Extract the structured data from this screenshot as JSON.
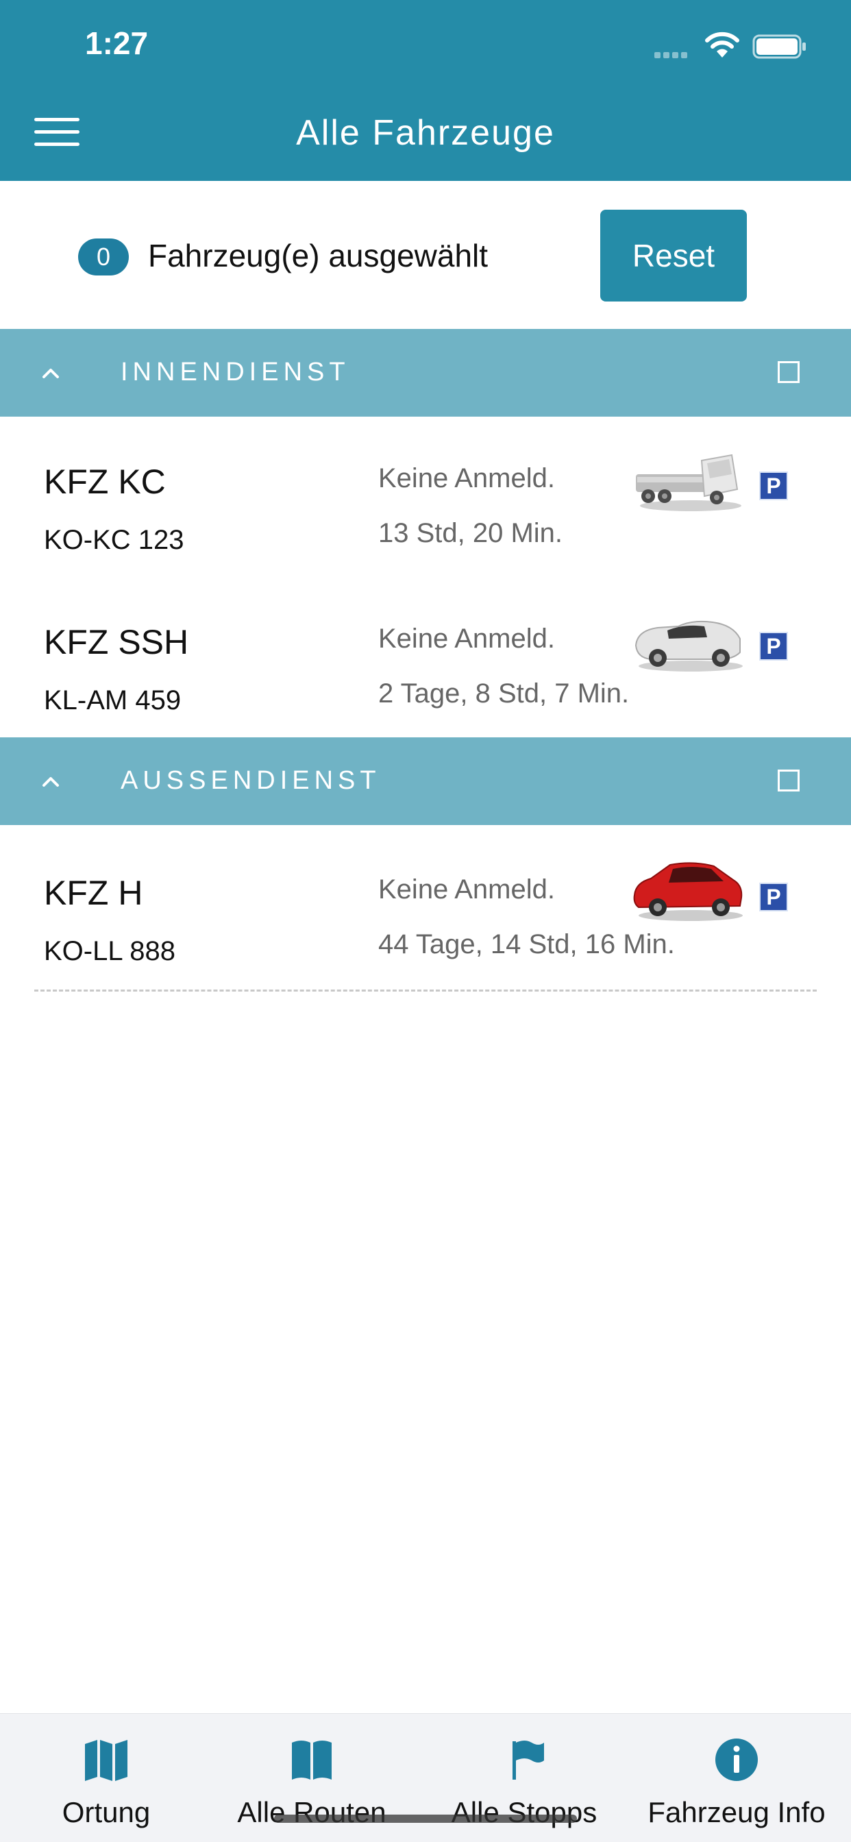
{
  "status_bar": {
    "time": "1:27"
  },
  "header": {
    "title": "Alle Fahrzeuge",
    "menu_icon": "hamburger-menu-icon"
  },
  "selection": {
    "count": "0",
    "label": "Fahrzeug(e) ausgewählt",
    "reset_label": "Reset"
  },
  "groups": [
    {
      "title": "INNENDIENST",
      "vehicles": [
        {
          "name": "KFZ KC",
          "plate": "KO-KC 123",
          "status": "Keine Anmeld.",
          "duration": "13 Std, 20 Min.",
          "image": "tractor-unit-image",
          "parking": "P"
        },
        {
          "name": "KFZ SSH",
          "plate": "KL-AM 459",
          "status": "Keine Anmeld.",
          "duration": "2 Tage, 8 Std, 7 Min.",
          "image": "convertible-car-image",
          "parking": "P"
        }
      ]
    },
    {
      "title": "AUSSENDIENST",
      "vehicles": [
        {
          "name": "KFZ H",
          "plate": "KO-LL 888",
          "status": "Keine Anmeld.",
          "duration": "44 Tage, 14 Std, 16 Min.",
          "image": "red-hatchback-car-image",
          "parking": "P"
        }
      ]
    }
  ],
  "tabs": [
    {
      "label": "Ortung",
      "icon": "map-icon"
    },
    {
      "label": "Alle Routen",
      "icon": "book-icon"
    },
    {
      "label": "Alle Stopps",
      "icon": "flag-icon"
    },
    {
      "label": "Fahrzeug Info",
      "icon": "info-icon"
    }
  ],
  "colors": {
    "header": "#258ca8",
    "group_header": "#70b3c5",
    "badge": "#1f7ea0",
    "parking": "#2b4fa8",
    "tab_icon": "#1f7ea0"
  }
}
